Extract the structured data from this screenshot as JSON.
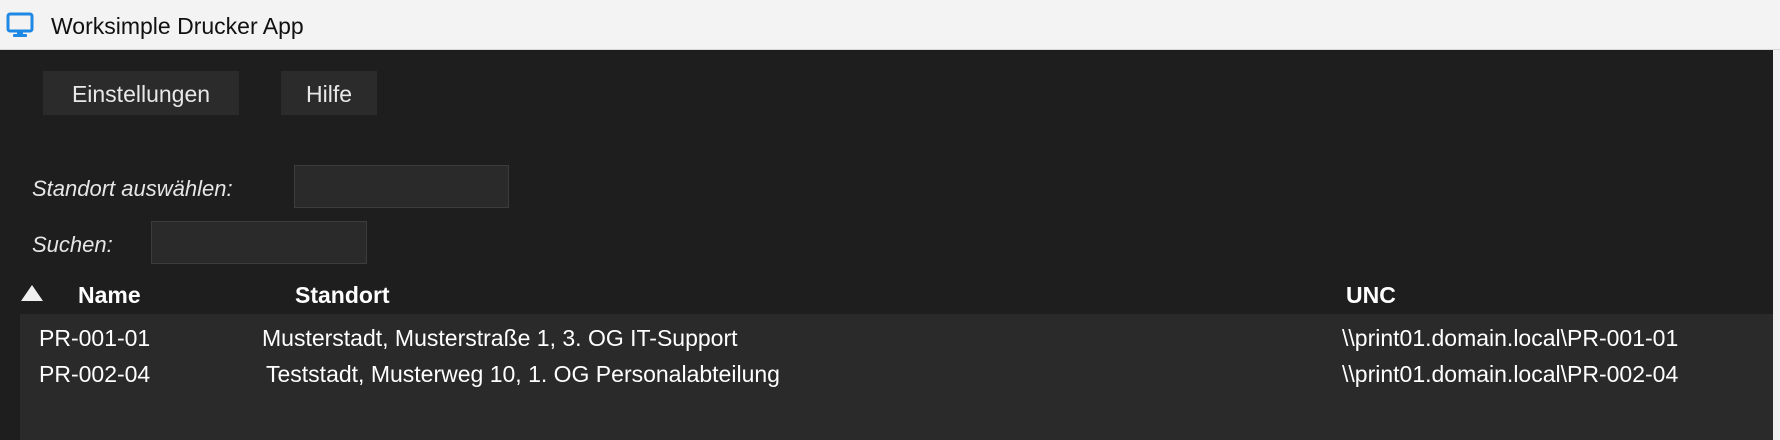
{
  "window": {
    "title": "Worksimple Drucker App",
    "icon": "monitor-icon"
  },
  "menu": {
    "settings_label": "Einstellungen",
    "help_label": "Hilfe"
  },
  "filters": {
    "location_label": "Standort auswählen:",
    "location_value": "",
    "search_label": "Suchen:",
    "search_value": ""
  },
  "table": {
    "sort_indicator": "triangle-up-icon",
    "columns": [
      "Name",
      "Standort",
      "UNC"
    ],
    "rows": [
      {
        "name": "PR-001-01",
        "location": "Musterstadt, Musterstraße 1, 3. OG IT-Support",
        "unc": "\\\\print01.domain.local\\PR-001-01"
      },
      {
        "name": "PR-002-04",
        "location": "Teststadt, Musterweg 10, 1. OG Personalabteilung",
        "unc": "\\\\print01.domain.local\\PR-002-04"
      }
    ]
  },
  "colors": {
    "background": "#1e1e1e",
    "titlebar": "#f3f3f3",
    "button": "#2b2b2b",
    "table_body": "#2a2a2a",
    "icon_accent": "#1e88e5"
  }
}
